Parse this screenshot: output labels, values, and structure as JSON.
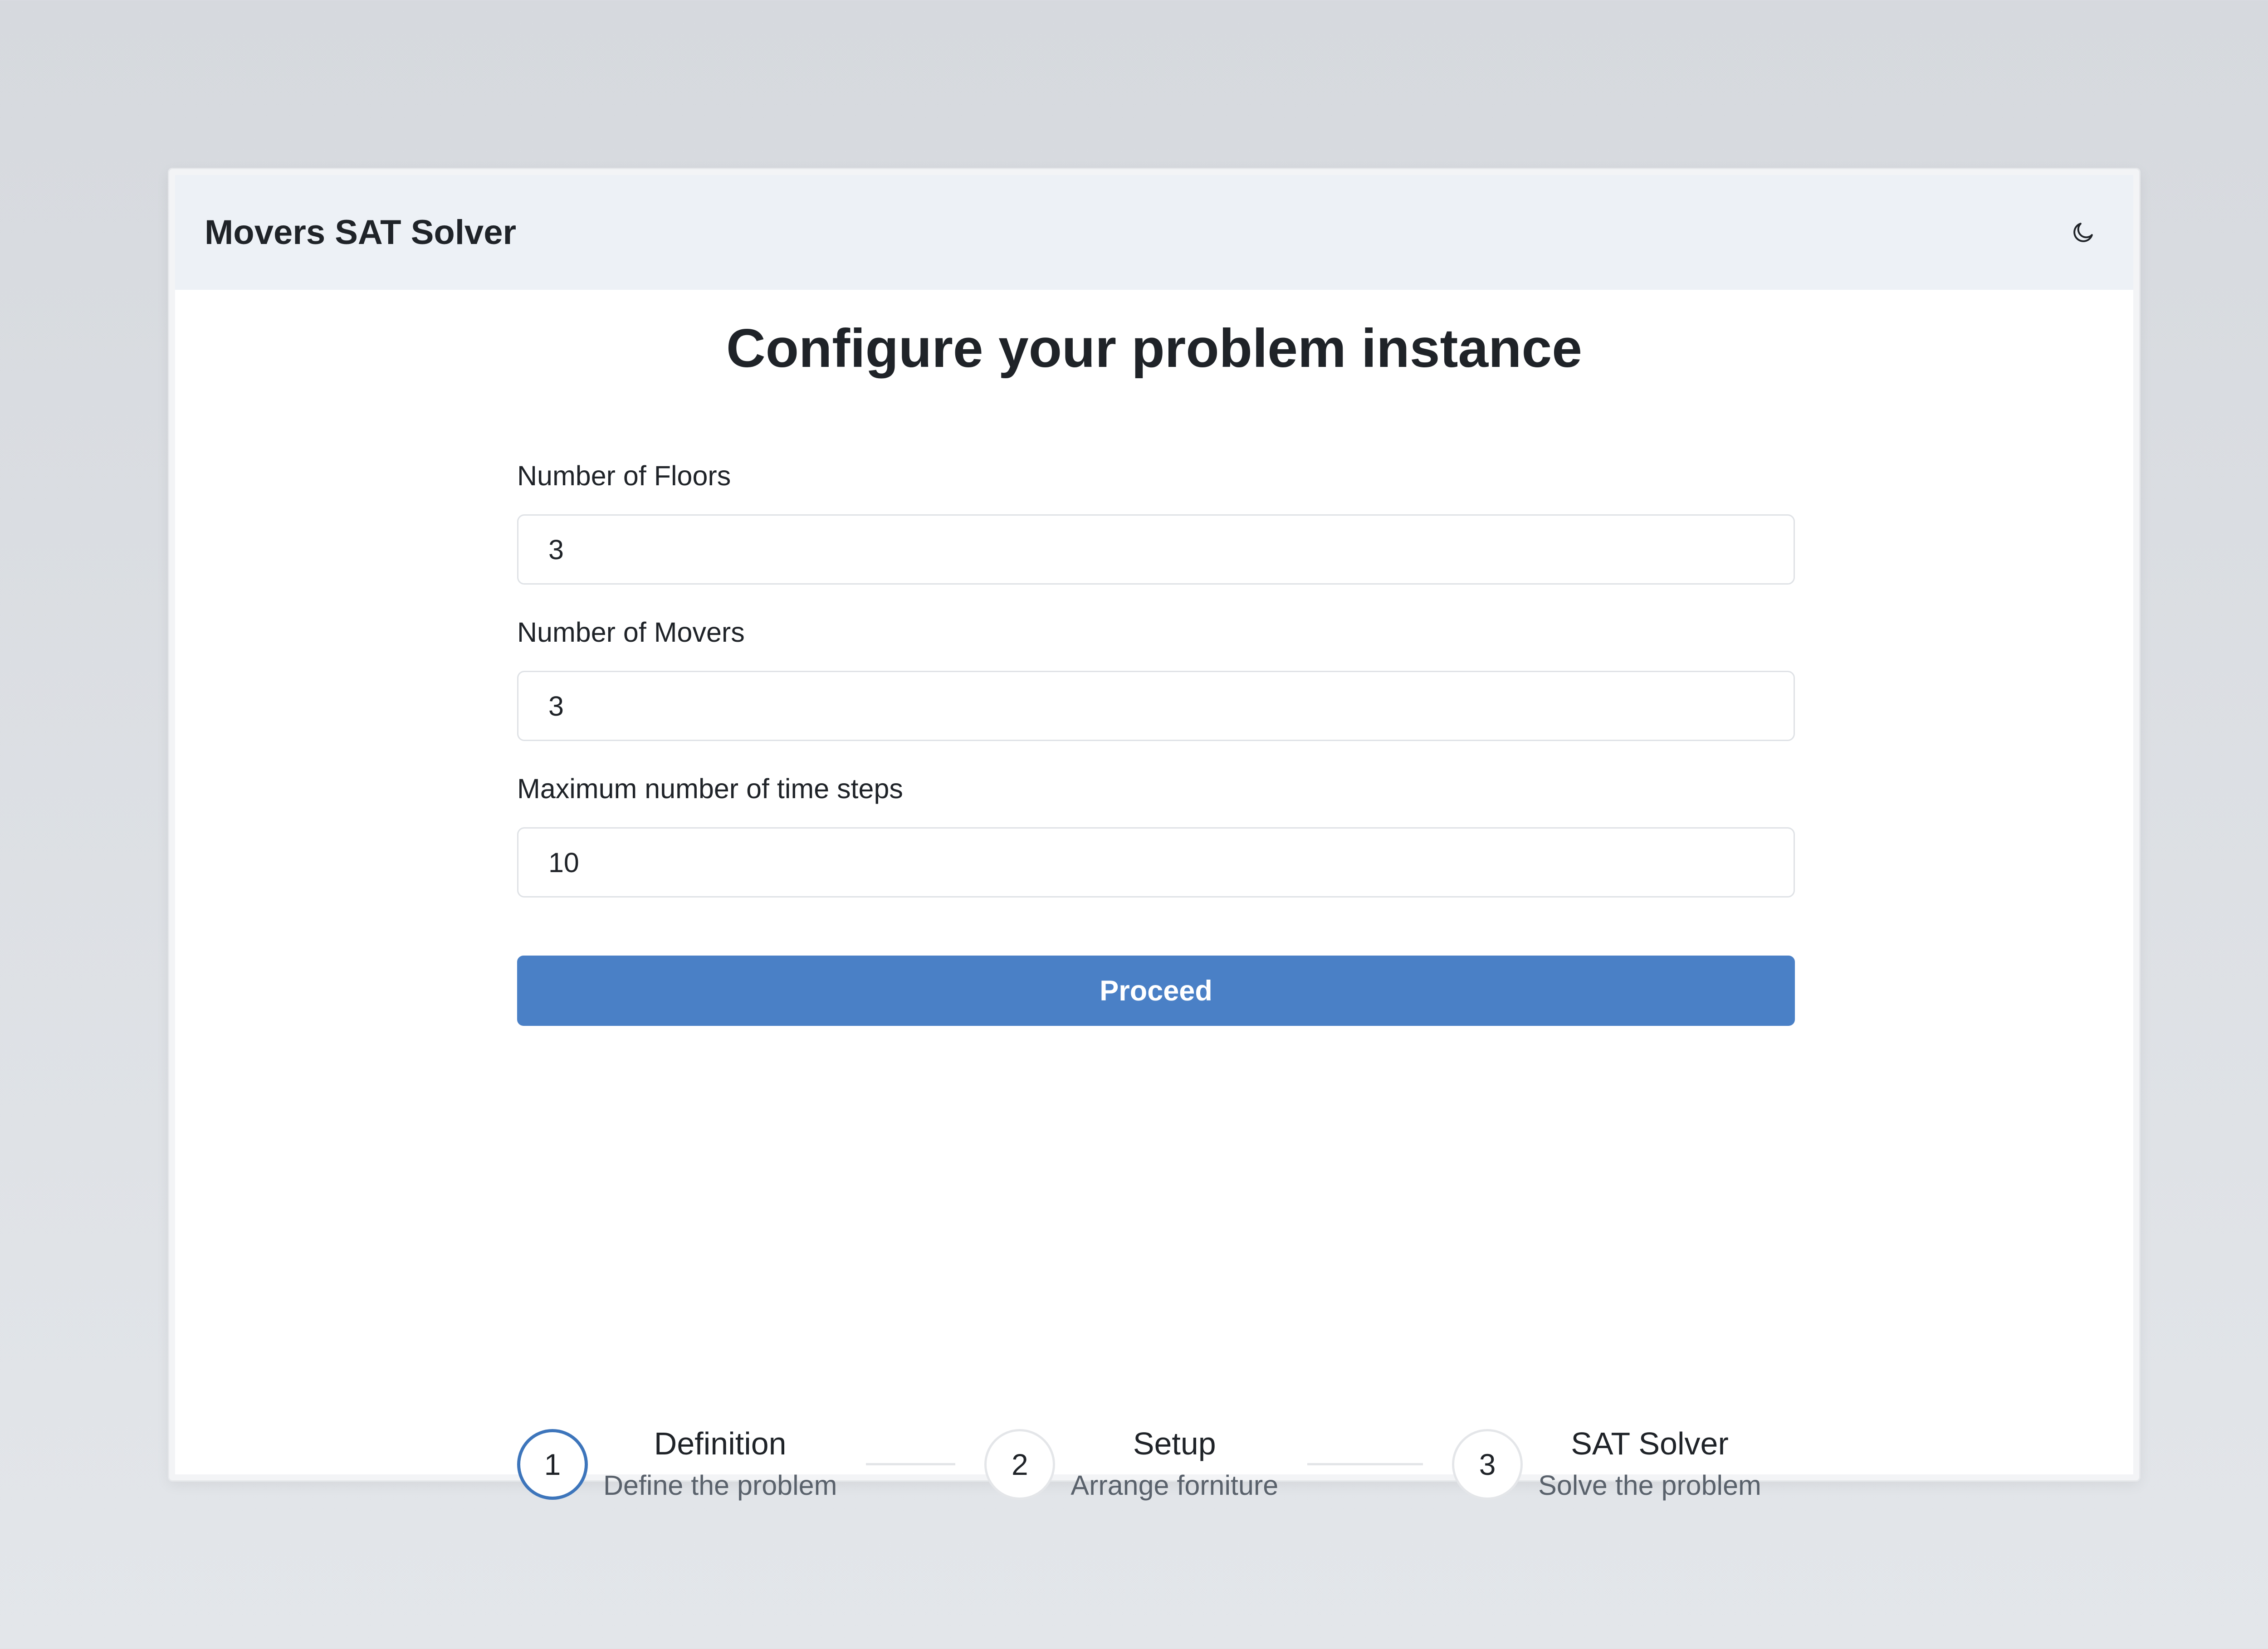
{
  "app": {
    "title": "Movers SAT Solver",
    "theme_toggle_icon": "moon-icon"
  },
  "page": {
    "title": "Configure your problem instance"
  },
  "form": {
    "floors": {
      "label": "Number of Floors",
      "value": "3"
    },
    "movers": {
      "label": "Number of Movers",
      "value": "3"
    },
    "time_steps": {
      "label": "Maximum number of time steps",
      "value": "10"
    },
    "proceed_label": "Proceed"
  },
  "stepper": {
    "steps": [
      {
        "number": "1",
        "title": "Definition",
        "description": "Define the problem",
        "active": true
      },
      {
        "number": "2",
        "title": "Setup",
        "description": "Arrange forniture",
        "active": false
      },
      {
        "number": "3",
        "title": "SAT Solver",
        "description": "Solve the problem",
        "active": false
      }
    ]
  },
  "colors": {
    "accent": "#4a80c6",
    "active_step_border": "#3d75bb",
    "header_bg": "#edf1f6"
  }
}
